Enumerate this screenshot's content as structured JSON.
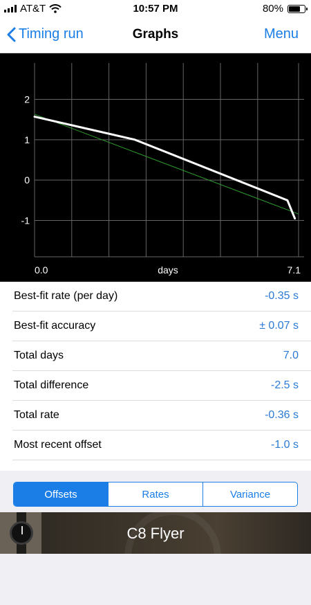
{
  "status_bar": {
    "carrier": "AT&T",
    "time": "10:57 PM",
    "battery_pct": "80%",
    "battery_level": 0.8
  },
  "nav": {
    "back_label": "Timing run",
    "title": "Graphs",
    "menu_label": "Menu"
  },
  "chart_data": {
    "type": "line",
    "xlabel": "days",
    "xlim": [
      0.0,
      7.1
    ],
    "x_tick_labels": [
      "0.0",
      "7.1"
    ],
    "ylim": [
      -1.9,
      2.9
    ],
    "y_ticks": [
      2,
      1,
      0,
      -1
    ],
    "y_tick_labels": [
      "2",
      "1",
      "0",
      "-1"
    ],
    "grid": true,
    "series": [
      {
        "style": "offsets",
        "color": "#ffffff",
        "x": [
          0.0,
          2.7,
          6.8,
          7.0
        ],
        "y": [
          1.57,
          1.0,
          -0.5,
          -0.95
        ]
      },
      {
        "style": "best-fit",
        "color": "#2e9e2e",
        "x": [
          0.0,
          7.1
        ],
        "y": [
          1.63,
          -0.84
        ]
      }
    ]
  },
  "stats": [
    {
      "label": "Best-fit rate (per day)",
      "value": "-0.35 s"
    },
    {
      "label": "Best-fit accuracy",
      "value": "± 0.07 s"
    },
    {
      "label": "Total days",
      "value": "7.0"
    },
    {
      "label": "Total difference",
      "value": "-2.5 s"
    },
    {
      "label": "Total rate",
      "value": "-0.36 s"
    },
    {
      "label": "Most recent offset",
      "value": "-1.0 s"
    }
  ],
  "segments": [
    {
      "label": "Offsets",
      "active": true
    },
    {
      "label": "Rates",
      "active": false
    },
    {
      "label": "Variance",
      "active": false
    }
  ],
  "banner": {
    "label": "C8 Flyer"
  }
}
